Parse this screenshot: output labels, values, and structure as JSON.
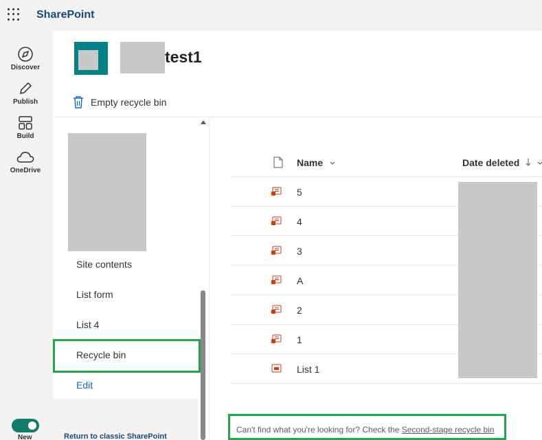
{
  "app": {
    "brand": "SharePoint"
  },
  "appbar": {
    "items": [
      {
        "label": "Discover"
      },
      {
        "label": "Publish"
      },
      {
        "label": "Build"
      },
      {
        "label": "OneDrive"
      }
    ],
    "new_label": "New"
  },
  "site": {
    "title_suffix": "test1"
  },
  "commands": {
    "empty_recycle_bin": "Empty recycle bin"
  },
  "leftnav": {
    "items": [
      "Site contents",
      "List form",
      "List 4",
      "Recycle bin"
    ],
    "edit": "Edit",
    "return_classic": "Return to classic SharePoint"
  },
  "list": {
    "columns": {
      "name": "Name",
      "date_deleted": "Date deleted"
    },
    "rows": [
      {
        "name": "5",
        "icon": "list-item-icon"
      },
      {
        "name": "4",
        "icon": "list-item-icon"
      },
      {
        "name": "3",
        "icon": "list-item-icon"
      },
      {
        "name": "A",
        "icon": "list-item-icon"
      },
      {
        "name": "2",
        "icon": "list-item-icon"
      },
      {
        "name": "1",
        "icon": "list-item-icon"
      },
      {
        "name": "List 1",
        "icon": "list-icon"
      }
    ]
  },
  "footer": {
    "message": "Can't find what you're looking for? Check the ",
    "link": "Second-stage recycle bin"
  },
  "colors": {
    "accent": "#038387",
    "highlight": "#1fa84a",
    "brand": "#0f4c81"
  }
}
